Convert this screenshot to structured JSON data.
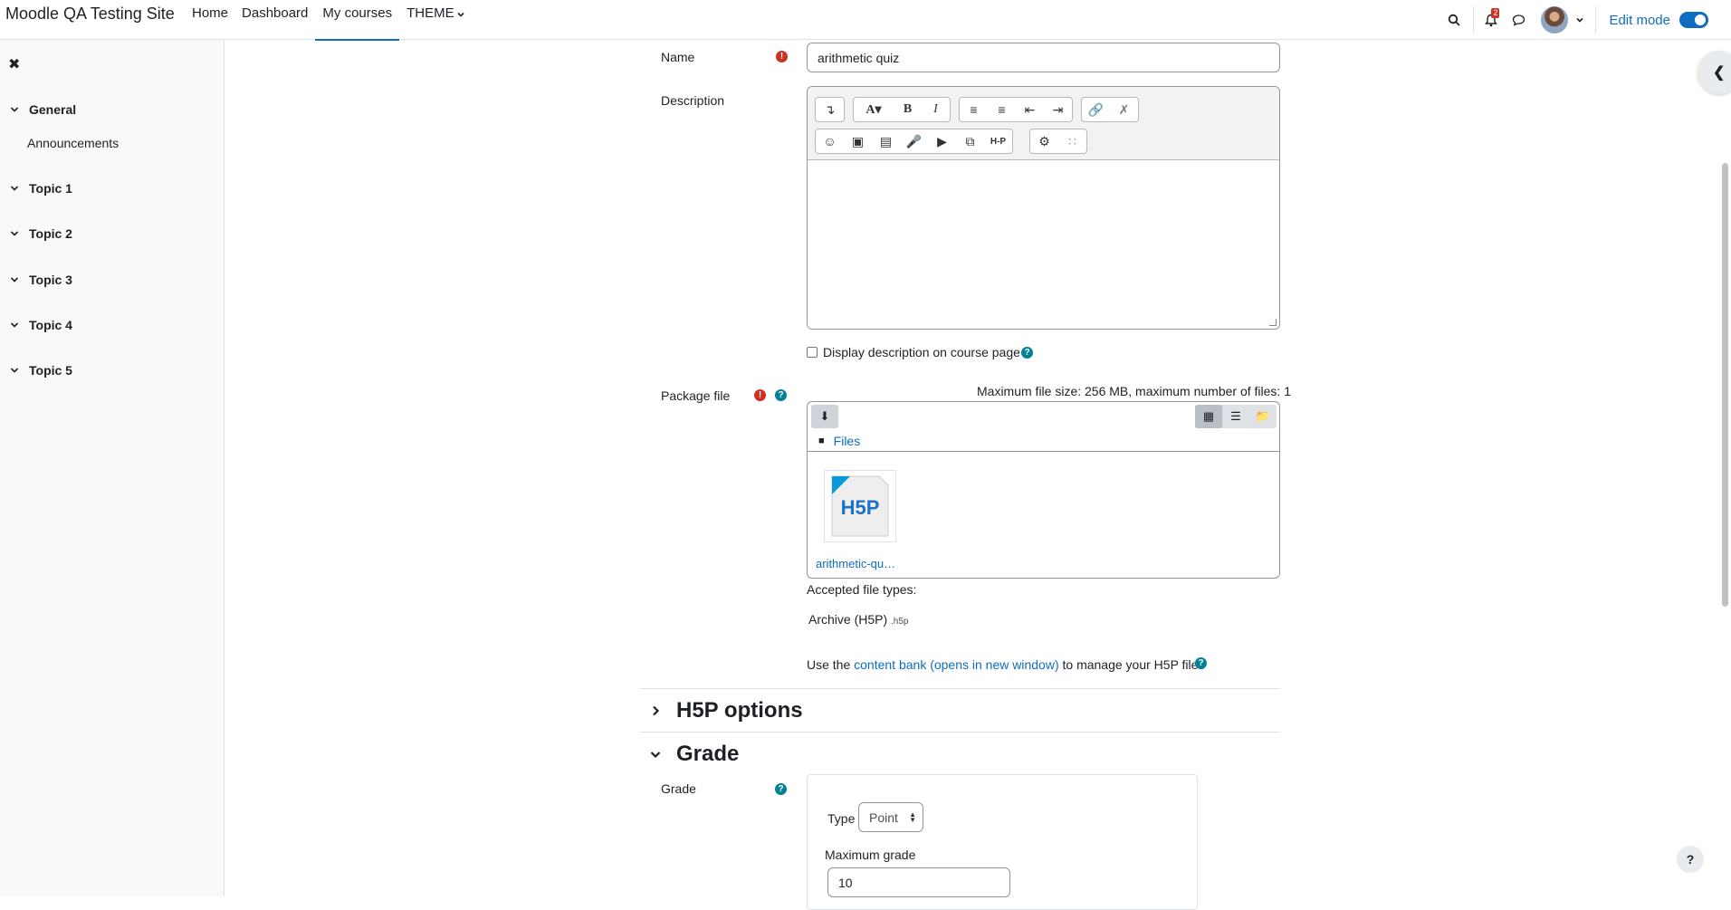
{
  "site": {
    "title": "Moodle QA Testing Site"
  },
  "nav": {
    "items": [
      {
        "label": "Home"
      },
      {
        "label": "Dashboard"
      },
      {
        "label": "My courses"
      },
      {
        "label": "THEME"
      }
    ],
    "notifications_count": "2",
    "edit_mode_label": "Edit mode",
    "edit_mode_on": true
  },
  "drawer": {
    "close_glyph": "✖",
    "sections": [
      {
        "label": "General",
        "children": [
          {
            "label": "Announcements"
          }
        ]
      },
      {
        "label": "Topic 1"
      },
      {
        "label": "Topic 2"
      },
      {
        "label": "Topic 3"
      },
      {
        "label": "Topic 4"
      },
      {
        "label": "Topic 5"
      }
    ]
  },
  "form": {
    "name": {
      "label": "Name",
      "value": "arithmetic quiz"
    },
    "description": {
      "label": "Description"
    },
    "display_description": {
      "label": "Display description on course page",
      "checked": false
    },
    "package_file": {
      "label": "Package file",
      "limits": "Maximum file size: 256 MB, maximum number of files: 1",
      "path_label": "Files",
      "file_name": "arithmetic-qu…",
      "accepted_label": "Accepted file types:",
      "accepted_type": "Archive (H5P)",
      "accepted_ext": ".h5p",
      "content_bank_prefix": "Use the",
      "content_bank_link": "content bank (opens in new window)",
      "content_bank_suffix": "to manage your H5P files"
    },
    "h5p_options": {
      "title": "H5P options"
    },
    "grade_section": {
      "title": "Grade"
    },
    "grade": {
      "label": "Grade",
      "type_label": "Type",
      "type_value": "Point",
      "max_label": "Maximum grade",
      "max_value": "10"
    }
  },
  "help_fab": "?",
  "colors": {
    "accent": "#0f6cbf",
    "required": "#ca3120",
    "help": "#008196"
  }
}
